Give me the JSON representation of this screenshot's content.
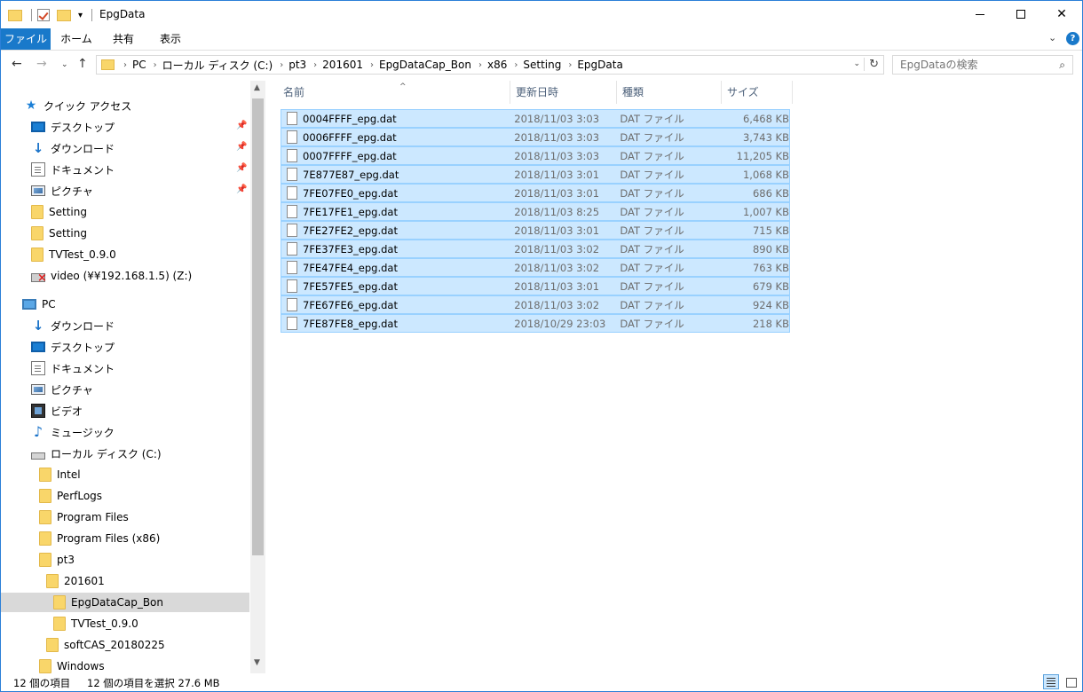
{
  "window": {
    "title": "EpgData",
    "accent_color": "#1979ca",
    "selection_color": "#cce8ff"
  },
  "ribbon": {
    "tabs": [
      {
        "label": "ファイル"
      },
      {
        "label": "ホーム"
      },
      {
        "label": "共有"
      },
      {
        "label": "表示"
      }
    ],
    "help_label": "?"
  },
  "address": {
    "crumbs": [
      "PC",
      "ローカル ディスク (C:)",
      "pt3",
      "201601",
      "EpgDataCap_Bon",
      "x86",
      "Setting",
      "EpgData"
    ]
  },
  "search": {
    "placeholder": "EpgDataの検索"
  },
  "nav": {
    "items": [
      {
        "label": "クイック アクセス",
        "icon": "star-icon"
      },
      {
        "label": "デスクトップ",
        "icon": "desktop-icon",
        "pinned": true
      },
      {
        "label": "ダウンロード",
        "icon": "download-icon",
        "pinned": true
      },
      {
        "label": "ドキュメント",
        "icon": "document-icon",
        "pinned": true
      },
      {
        "label": "ピクチャ",
        "icon": "pictures-icon",
        "pinned": true
      },
      {
        "label": "Setting",
        "icon": "folder-icon"
      },
      {
        "label": "Setting",
        "icon": "folder-icon"
      },
      {
        "label": "TVTest_0.9.0",
        "icon": "folder-icon"
      },
      {
        "label": "video (¥¥192.168.1.5) (Z:)",
        "icon": "network-drive-disconnected-icon"
      },
      {
        "label": "PC",
        "icon": "pc-icon"
      },
      {
        "label": "ダウンロード",
        "icon": "download-icon"
      },
      {
        "label": "デスクトップ",
        "icon": "desktop-icon"
      },
      {
        "label": "ドキュメント",
        "icon": "document-icon"
      },
      {
        "label": "ピクチャ",
        "icon": "pictures-icon"
      },
      {
        "label": "ビデオ",
        "icon": "videos-icon"
      },
      {
        "label": "ミュージック",
        "icon": "music-icon"
      },
      {
        "label": "ローカル ディスク (C:)",
        "icon": "drive-icon"
      },
      {
        "label": "Intel",
        "icon": "folder-icon"
      },
      {
        "label": "PerfLogs",
        "icon": "folder-icon"
      },
      {
        "label": "Program Files",
        "icon": "folder-icon"
      },
      {
        "label": "Program Files (x86)",
        "icon": "folder-icon"
      },
      {
        "label": "pt3",
        "icon": "folder-icon"
      },
      {
        "label": "201601",
        "icon": "folder-icon"
      },
      {
        "label": "EpgDataCap_Bon",
        "icon": "folder-icon",
        "selected": true
      },
      {
        "label": "TVTest_0.9.0",
        "icon": "folder-icon"
      },
      {
        "label": "softCAS_20180225",
        "icon": "folder-icon"
      },
      {
        "label": "Windows",
        "icon": "folder-icon"
      }
    ]
  },
  "columns": {
    "name": "名前",
    "date": "更新日時",
    "type": "種類",
    "size": "サイズ"
  },
  "files": [
    {
      "name": "0004FFFF_epg.dat",
      "date": "2018/11/03 3:03",
      "type": "DAT ファイル",
      "size": "6,468 KB"
    },
    {
      "name": "0006FFFF_epg.dat",
      "date": "2018/11/03 3:03",
      "type": "DAT ファイル",
      "size": "3,743 KB"
    },
    {
      "name": "0007FFFF_epg.dat",
      "date": "2018/11/03 3:03",
      "type": "DAT ファイル",
      "size": "11,205 KB"
    },
    {
      "name": "7E877E87_epg.dat",
      "date": "2018/11/03 3:01",
      "type": "DAT ファイル",
      "size": "1,068 KB"
    },
    {
      "name": "7FE07FE0_epg.dat",
      "date": "2018/11/03 3:01",
      "type": "DAT ファイル",
      "size": "686 KB"
    },
    {
      "name": "7FE17FE1_epg.dat",
      "date": "2018/11/03 8:25",
      "type": "DAT ファイル",
      "size": "1,007 KB"
    },
    {
      "name": "7FE27FE2_epg.dat",
      "date": "2018/11/03 3:01",
      "type": "DAT ファイル",
      "size": "715 KB"
    },
    {
      "name": "7FE37FE3_epg.dat",
      "date": "2018/11/03 3:02",
      "type": "DAT ファイル",
      "size": "890 KB"
    },
    {
      "name": "7FE47FE4_epg.dat",
      "date": "2018/11/03 3:02",
      "type": "DAT ファイル",
      "size": "763 KB"
    },
    {
      "name": "7FE57FE5_epg.dat",
      "date": "2018/11/03 3:01",
      "type": "DAT ファイル",
      "size": "679 KB"
    },
    {
      "name": "7FE67FE6_epg.dat",
      "date": "2018/11/03 3:02",
      "type": "DAT ファイル",
      "size": "924 KB"
    },
    {
      "name": "7FE87FE8_epg.dat",
      "date": "2018/10/29 23:03",
      "type": "DAT ファイル",
      "size": "218 KB"
    }
  ],
  "status": {
    "item_count": "12 個の項目",
    "selected": "12 個の項目を選択  27.6 MB"
  }
}
